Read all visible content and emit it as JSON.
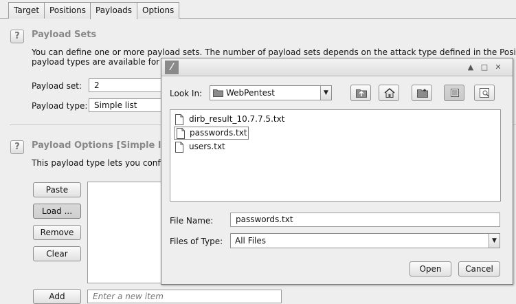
{
  "tabs": [
    {
      "label": "Target"
    },
    {
      "label": "Positions"
    },
    {
      "label": "Payloads"
    },
    {
      "label": "Options"
    }
  ],
  "help_glyph": "?",
  "payload_sets": {
    "title": "Payload Sets",
    "description_line1": "You can define one or more payload sets. The number of payload sets depends on the attack type defined in the Positions",
    "description_line2": "payload types are available for e",
    "set_label": "Payload set:",
    "set_value": "2",
    "type_label": "Payload type:",
    "type_value": "Simple list"
  },
  "payload_options": {
    "title": "Payload Options [Simple l",
    "description": "This payload type lets you config",
    "buttons": {
      "paste": "Paste",
      "load": "Load ...",
      "remove": "Remove",
      "clear": "Clear",
      "add": "Add"
    },
    "new_item_placeholder": "Enter a new item"
  },
  "dialog": {
    "app_icon_glyph": "⁄",
    "look_in_label": "Look In:",
    "look_in_value": "WebPentest",
    "files": [
      {
        "name": "dirb_result_10.7.7.5.txt",
        "selected": false
      },
      {
        "name": "passwords.txt",
        "selected": true
      },
      {
        "name": "users.txt",
        "selected": false
      }
    ],
    "file_name_label": "File Name:",
    "file_name_value": "passwords.txt",
    "files_of_type_label": "Files of Type:",
    "files_of_type_value": "All Files",
    "open_label": "Open",
    "cancel_label": "Cancel"
  },
  "icons": {
    "window_controls": [
      "maximize-icon",
      "restore-icon",
      "close-icon"
    ],
    "toolbar": [
      "up-folder-icon",
      "home-icon",
      "new-folder-icon",
      "list-view-icon",
      "details-view-icon"
    ]
  }
}
